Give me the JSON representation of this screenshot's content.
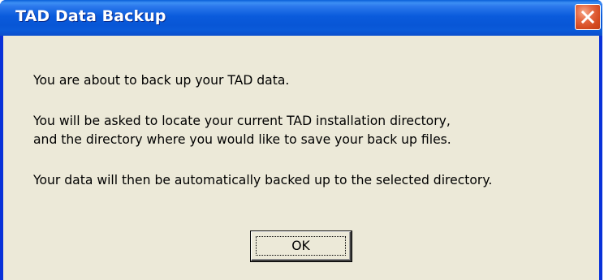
{
  "window": {
    "title": "TAD Data Backup",
    "close_icon": "close-icon"
  },
  "message": {
    "line1": "You are about to back up your TAD data.",
    "line2": "You will be asked to locate your current TAD installation directory,",
    "line3": "and the directory where you would like to save your back up files.",
    "line4": "Your data will then be automatically backed up to the selected directory."
  },
  "buttons": {
    "ok_label": "OK"
  },
  "colors": {
    "titlebar": "#0a5bdc",
    "client": "#ece9d8",
    "close_button": "#d44a20"
  }
}
